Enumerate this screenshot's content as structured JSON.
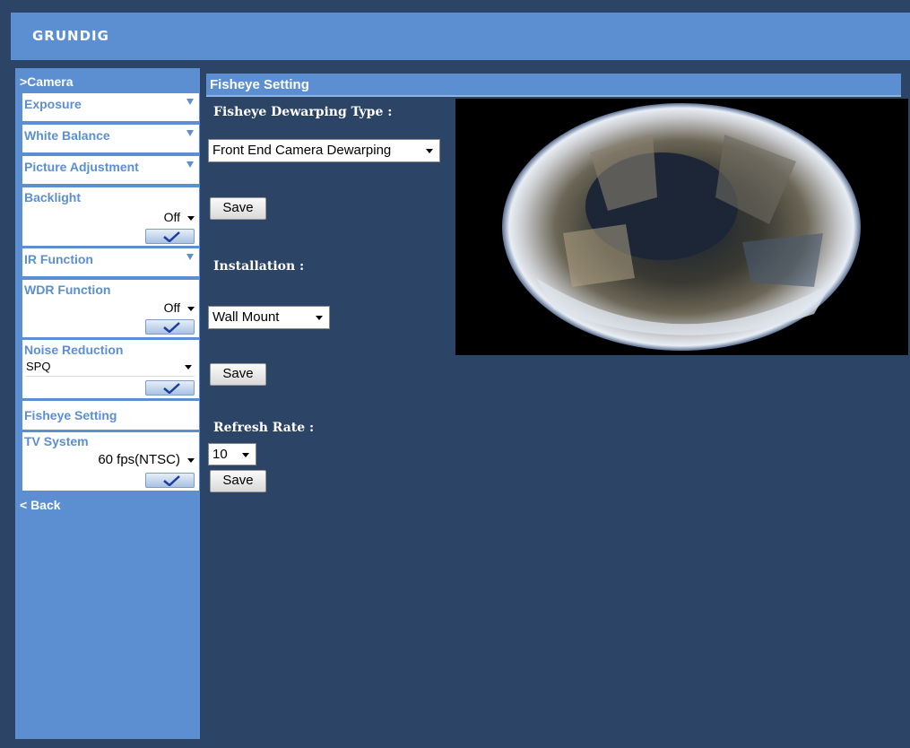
{
  "brand": "GRUNDIG",
  "sidebar": {
    "title": ">Camera",
    "items": [
      {
        "label": "Exposure"
      },
      {
        "label": "White Balance"
      },
      {
        "label": "Picture Adjustment"
      },
      {
        "label": "Backlight",
        "value": "Off"
      },
      {
        "label": "IR Function"
      },
      {
        "label": "WDR Function",
        "value": "Off"
      },
      {
        "label": "Noise Reduction",
        "value": "SPQ"
      },
      {
        "label": "Fisheye Setting"
      },
      {
        "label": "TV System",
        "value": "60 fps(NTSC)"
      }
    ],
    "back": "< Back"
  },
  "main": {
    "header": "Fisheye Setting",
    "dewarp_label": "Fisheye Dewarping Type :",
    "dewarp_value": "Front End Camera Dewarping",
    "install_label": "Installation :",
    "install_value": "Wall Mount",
    "refresh_label": "Refresh Rate :",
    "refresh_value": "10",
    "save_label": "Save"
  }
}
